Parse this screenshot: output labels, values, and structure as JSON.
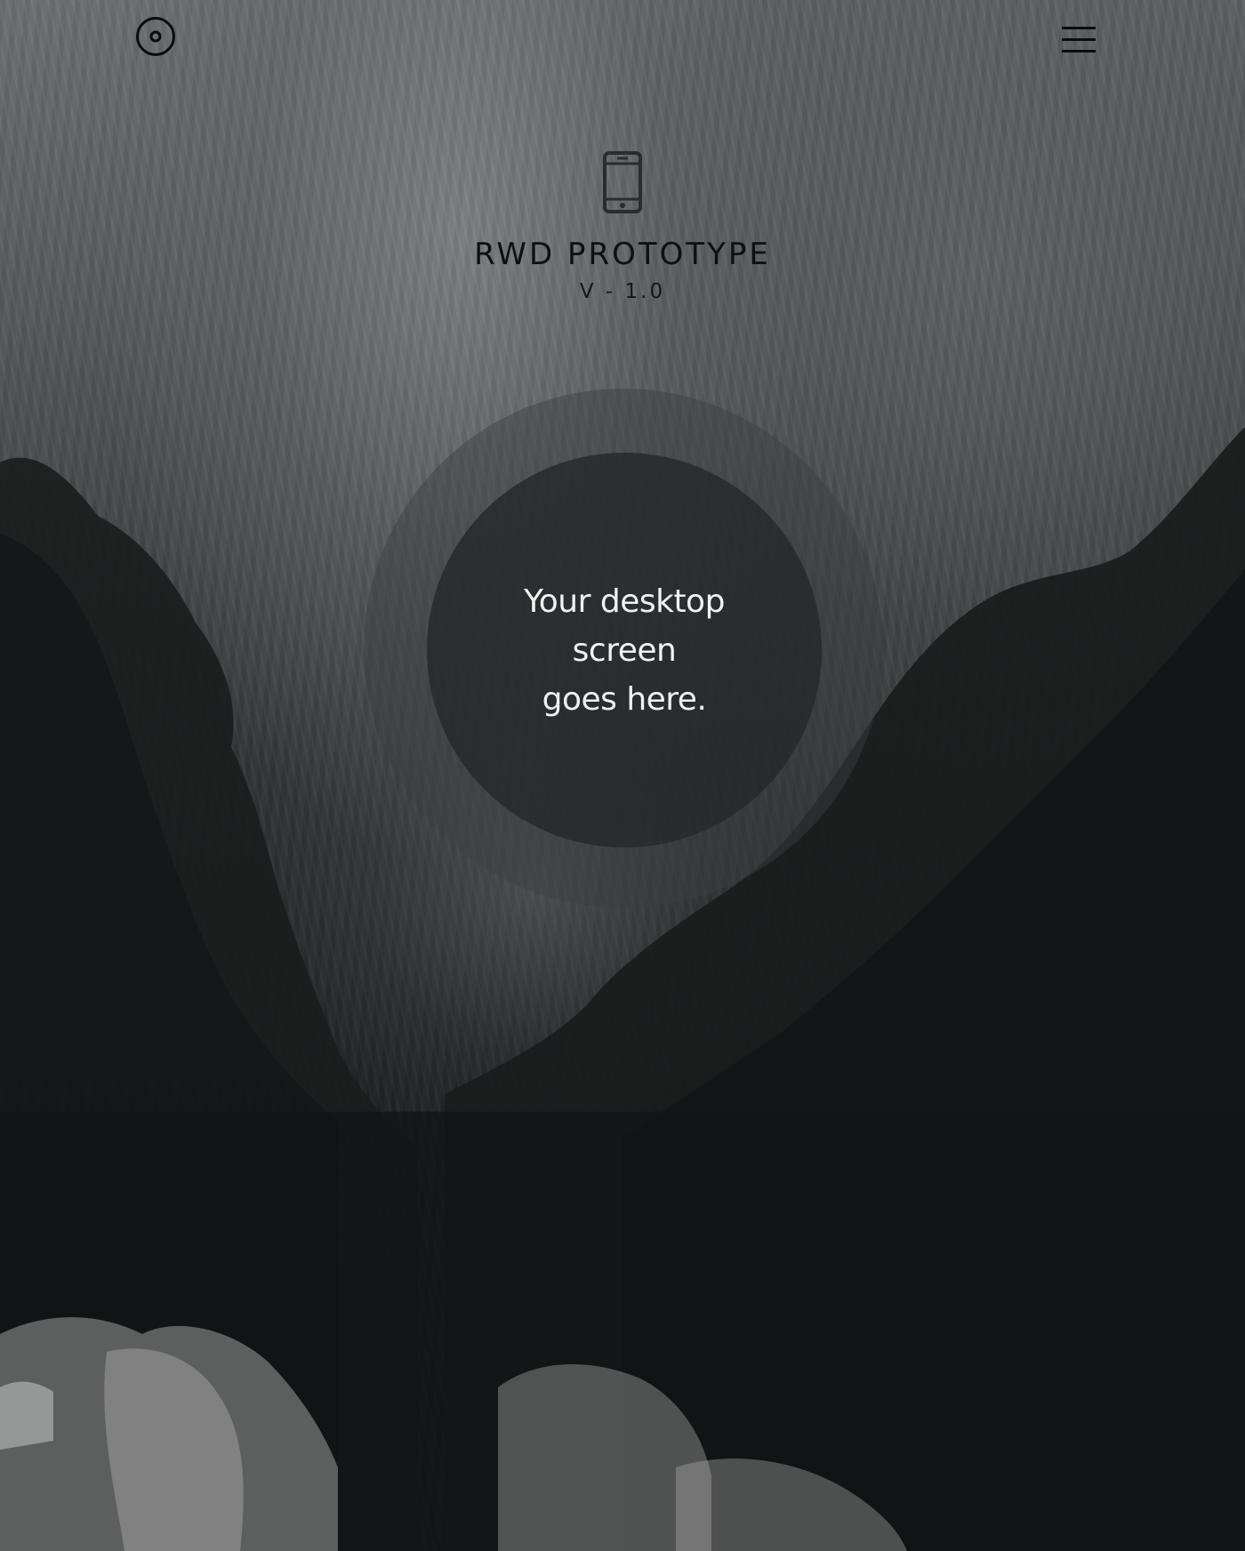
{
  "header": {
    "logo_icon": "record-circle-icon",
    "menu_icon": "hamburger-menu-icon"
  },
  "hero": {
    "device_icon": "mobile-phone-icon",
    "title": "RWD PROTOTYPE",
    "version": "V - 1.0"
  },
  "placeholder": {
    "line1": "Your desktop",
    "line2": "screen",
    "line3": "goes here."
  },
  "colors": {
    "title_text": "#0e0f10",
    "placeholder_text": "#f2f2f2",
    "inner_circle": "#262829",
    "outer_circle": "#3c3f40"
  }
}
